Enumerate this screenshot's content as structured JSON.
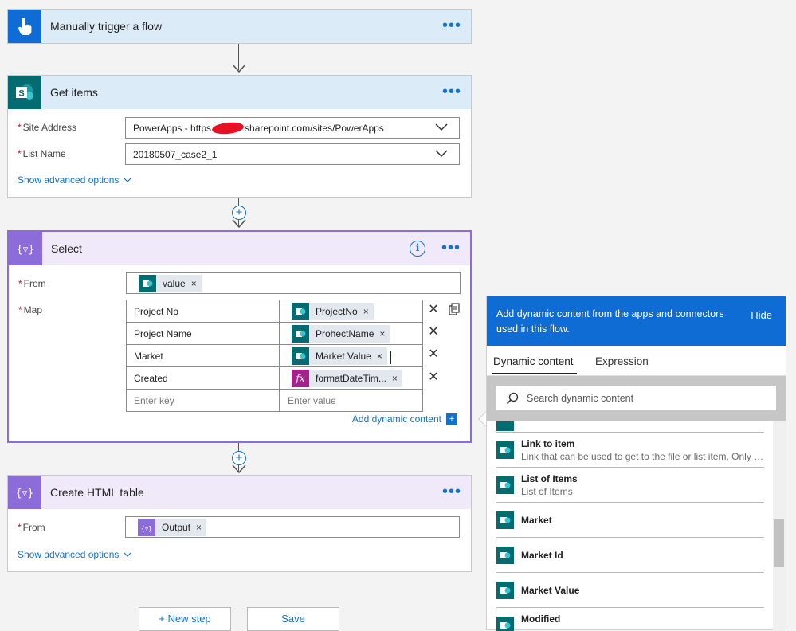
{
  "trigger": {
    "title": "Manually trigger a flow"
  },
  "get_items": {
    "title": "Get items",
    "site_address_label": "Site Address",
    "site_address_prefix": "PowerApps - https",
    "site_address_suffix": "sharepoint.com/sites/PowerApps",
    "list_name_label": "List Name",
    "list_name_value": "20180507_case2_1",
    "advanced_label": "Show advanced options"
  },
  "select": {
    "title": "Select",
    "from_label": "From",
    "from_token": "value",
    "map_label": "Map",
    "map_rows": [
      {
        "key": "Project No",
        "value": "ProjectNo",
        "icon": "sharepoint"
      },
      {
        "key": "Project Name",
        "value": "ProhectName",
        "icon": "sharepoint"
      },
      {
        "key": "Market",
        "value": "Market Value",
        "icon": "sharepoint"
      },
      {
        "key": "Created",
        "value": "formatDateTim...",
        "icon": "expression"
      }
    ],
    "key_placeholder": "Enter key",
    "value_placeholder": "Enter value",
    "add_dynamic_label": "Add dynamic content"
  },
  "html_table": {
    "title": "Create HTML table",
    "from_label": "From",
    "from_token": "Output",
    "advanced_label": "Show advanced options"
  },
  "bottom_buttons": {
    "new_step": "+ New step",
    "save": "Save"
  },
  "dynamic_panel": {
    "header": "Add dynamic content from the apps and connectors used in this flow.",
    "hide_label": "Hide",
    "tabs": [
      "Dynamic content",
      "Expression"
    ],
    "active_tab": "Dynamic content",
    "search_placeholder": "Search dynamic content",
    "items": [
      {
        "title": "Link to item",
        "desc": "Link that can be used to get to the file or list item. Only p..."
      },
      {
        "title": "List of Items",
        "desc": "List of Items"
      },
      {
        "title": "Market",
        "desc": ""
      },
      {
        "title": "Market Id",
        "desc": ""
      },
      {
        "title": "Market Value",
        "desc": ""
      },
      {
        "title": "Modified",
        "desc": ""
      }
    ]
  },
  "colors": {
    "accent": "#0f6cd5",
    "sharepoint": "#036c70",
    "select": "#8c6cd9",
    "expression": "#a4228a"
  }
}
